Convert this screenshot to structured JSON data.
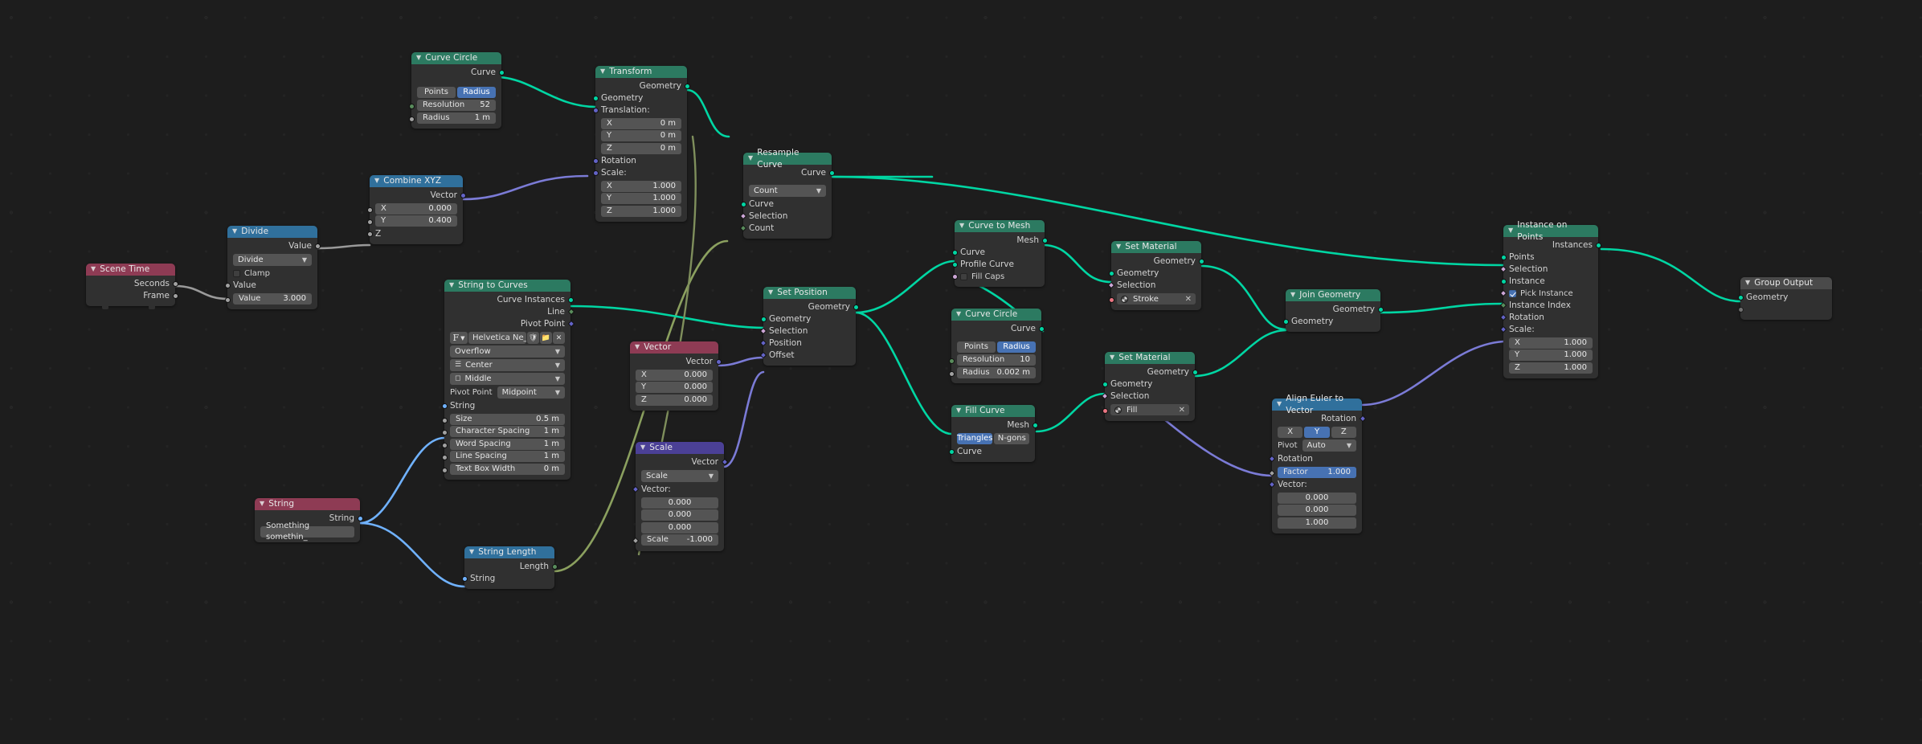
{
  "app": {
    "editor": "Blender Geometry Node Editor",
    "background": "#1d1d1d"
  },
  "colors": {
    "geometry_header": "#2c7a61",
    "vector_header": "#4b4096",
    "input_header": "#8e3b54",
    "converter_header": "#30709c",
    "output_header": "#4a4a4a",
    "accent_blue": "#4772b3",
    "wire_geometry": "#00d6a3",
    "wire_vector": "#6363c7",
    "wire_value": "#9a9a9a",
    "wire_string": "#70b2ff",
    "wire_field": "#8ba05f"
  },
  "nodes": {
    "scene_time": {
      "title": "Scene Time",
      "outputs": [
        "Seconds",
        "Frame"
      ]
    },
    "divide": {
      "title": "Divide",
      "output": "Value",
      "operation": "Divide",
      "clamp_label": "Clamp",
      "clamp_checked": false,
      "input_label": "Value",
      "value_label": "Value",
      "value": "3.000"
    },
    "combine_xyz": {
      "title": "Combine XYZ",
      "output": "Vector",
      "x_label": "X",
      "x_value": "0.000",
      "y_label": "Y",
      "y_value": "0.400",
      "z_label": "Z"
    },
    "curve_circle_1": {
      "title": "Curve Circle",
      "output": "Curve",
      "mode_points": "Points",
      "mode_radius": "Radius",
      "mode_selected": "Radius",
      "resolution_label": "Resolution",
      "resolution_value": "52",
      "radius_label": "Radius",
      "radius_value": "1 m"
    },
    "transform": {
      "title": "Transform",
      "output": "Geometry",
      "geometry_label": "Geometry",
      "translation_label": "Translation:",
      "translation": [
        {
          "axis": "X",
          "value": "0 m"
        },
        {
          "axis": "Y",
          "value": "0 m"
        },
        {
          "axis": "Z",
          "value": "0 m"
        }
      ],
      "rotation_label": "Rotation",
      "scale_label": "Scale:",
      "scale": [
        {
          "axis": "X",
          "value": "1.000"
        },
        {
          "axis": "Y",
          "value": "1.000"
        },
        {
          "axis": "Z",
          "value": "1.000"
        }
      ]
    },
    "resample_curve": {
      "title": "Resample Curve",
      "output": "Curve",
      "mode": "Count",
      "inputs": [
        "Curve",
        "Selection",
        "Count"
      ]
    },
    "string_to_curves": {
      "title": "String to Curves",
      "outputs": [
        "Curve Instances",
        "Line",
        "Pivot Point"
      ],
      "font_name": "Helvetica Ne_",
      "overflow": "Overflow",
      "align_x": "Center",
      "align_y": "Middle",
      "pivot_point_label": "Pivot Point",
      "pivot_point_value": "Midpoint",
      "string_label": "String",
      "fields": [
        {
          "label": "Size",
          "value": "0.5 m"
        },
        {
          "label": "Character Spacing",
          "value": "1 m"
        },
        {
          "label": "Word Spacing",
          "value": "1 m"
        },
        {
          "label": "Line Spacing",
          "value": "1 m"
        },
        {
          "label": "Text Box Width",
          "value": "0 m"
        }
      ]
    },
    "string": {
      "title": "String",
      "output": "String",
      "value": "Something somethin_"
    },
    "string_length": {
      "title": "String Length",
      "output": "Length",
      "input": "String"
    },
    "vector": {
      "title": "Vector",
      "output": "Vector",
      "components": [
        {
          "axis": "X",
          "value": "0.000"
        },
        {
          "axis": "Y",
          "value": "0.000"
        },
        {
          "axis": "Z",
          "value": "0.000"
        }
      ]
    },
    "scale": {
      "title": "Scale",
      "output": "Vector",
      "operation": "Scale",
      "vector_label": "Vector:",
      "vector": [
        "0.000",
        "0.000",
        "0.000"
      ],
      "scale_label": "Scale",
      "scale_value": "-1.000"
    },
    "set_position": {
      "title": "Set Position",
      "output": "Geometry",
      "inputs": [
        "Geometry",
        "Selection",
        "Position",
        "Offset"
      ]
    },
    "curve_to_mesh": {
      "title": "Curve to Mesh",
      "output": "Mesh",
      "inputs": [
        "Curve",
        "Profile Curve"
      ],
      "fill_caps_label": "Fill Caps",
      "fill_caps_checked": false
    },
    "curve_circle_2": {
      "title": "Curve Circle",
      "output": "Curve",
      "mode_points": "Points",
      "mode_radius": "Radius",
      "mode_selected": "Radius",
      "resolution_label": "Resolution",
      "resolution_value": "10",
      "radius_label": "Radius",
      "radius_value": "0.002 m"
    },
    "fill_curve": {
      "title": "Fill Curve",
      "output": "Mesh",
      "mode_triangles": "Triangles",
      "mode_ngons": "N-gons",
      "mode_selected": "Triangles",
      "input": "Curve"
    },
    "set_material_stroke": {
      "title": "Set Material",
      "output": "Geometry",
      "inputs": [
        "Geometry",
        "Selection"
      ],
      "material": "Stroke"
    },
    "set_material_fill": {
      "title": "Set Material",
      "output": "Geometry",
      "inputs": [
        "Geometry",
        "Selection"
      ],
      "material": "Fill"
    },
    "align_euler_to_vector": {
      "title": "Align Euler to Vector",
      "output": "Rotation",
      "axis_x": "X",
      "axis_y": "Y",
      "axis_z": "Z",
      "axis_selected": "Y",
      "pivot_label": "Pivot",
      "pivot_value": "Auto",
      "rotation_label": "Rotation",
      "factor_label": "Factor",
      "factor_value": "1.000",
      "vector_label": "Vector:",
      "vector": [
        "0.000",
        "0.000",
        "1.000"
      ]
    },
    "join_geometry": {
      "title": "Join Geometry",
      "output": "Geometry",
      "input": "Geometry"
    },
    "instance_on_points": {
      "title": "Instance on Points",
      "output": "Instances",
      "inputs": [
        "Points",
        "Selection",
        "Instance"
      ],
      "pick_instance_label": "Pick Instance",
      "pick_instance_checked": true,
      "instance_index_label": "Instance Index",
      "rotation_label": "Rotation",
      "scale_label": "Scale:",
      "scale": [
        {
          "axis": "X",
          "value": "1.000"
        },
        {
          "axis": "Y",
          "value": "1.000"
        },
        {
          "axis": "Z",
          "value": "1.000"
        }
      ]
    },
    "group_output": {
      "title": "Group Output",
      "input": "Geometry"
    }
  }
}
